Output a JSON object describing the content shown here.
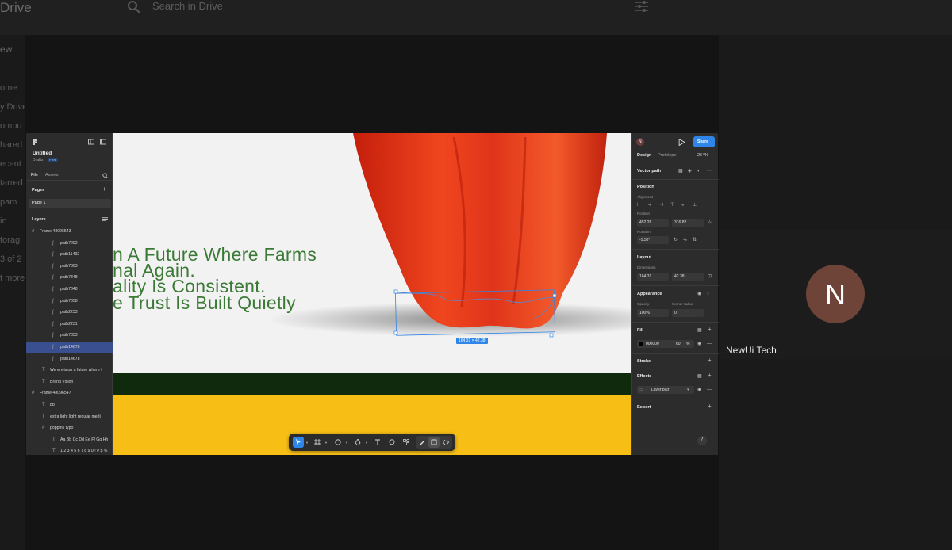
{
  "drive": {
    "title": "Drive",
    "search_placeholder": "Search in Drive",
    "new_label": "ew",
    "sidebar": [
      "ome",
      "y Drive",
      "ompu",
      "hared",
      "ecent",
      "tarred",
      "pam",
      "in",
      "torag",
      "3 of 2",
      "t more"
    ]
  },
  "figma": {
    "file": {
      "title": "Untitled",
      "subtitle": "Drafts",
      "badge": "Free"
    },
    "left_tabs": {
      "file": "File",
      "assets": "Assets"
    },
    "pages_header": "Pages",
    "page_item": "Page 1",
    "layers_header": "Layers",
    "layers": [
      {
        "icon": "#",
        "label": "Frame 48096543",
        "indent": 0
      },
      {
        "icon": "∫",
        "label": "path7292",
        "indent": 2
      },
      {
        "icon": "∫",
        "label": "path11432",
        "indent": 2
      },
      {
        "icon": "∫",
        "label": "path7363",
        "indent": 2
      },
      {
        "icon": "∫",
        "label": "path7348",
        "indent": 2
      },
      {
        "icon": "∫",
        "label": "path7348",
        "indent": 2
      },
      {
        "icon": "∫",
        "label": "path7358",
        "indent": 2
      },
      {
        "icon": "∫",
        "label": "path2233",
        "indent": 2
      },
      {
        "icon": "∫",
        "label": "path2231",
        "indent": 2
      },
      {
        "icon": "∫",
        "label": "path7353",
        "indent": 2
      },
      {
        "icon": "∫",
        "label": "path14678",
        "indent": 2,
        "selected": true
      },
      {
        "icon": "∫",
        "label": "path14678",
        "indent": 2
      },
      {
        "icon": "T",
        "label": "We envision a future where f",
        "indent": 1
      },
      {
        "icon": "T",
        "label": "Brand Vision",
        "indent": 1
      },
      {
        "icon": "#",
        "label": "Frame 48096547",
        "indent": 0
      },
      {
        "icon": "T",
        "label": "bb",
        "indent": 1
      },
      {
        "icon": "T",
        "label": "extra light light regular medi",
        "indent": 1
      },
      {
        "icon": "#",
        "label": "poppins typo",
        "indent": 1
      },
      {
        "icon": "T",
        "label": "Aa Bb Cc Dd Ee Ff Gg Hh",
        "indent": 2
      },
      {
        "icon": "T",
        "label": "1 2 3 4 5 6 7 8 9 0 ! # $ %",
        "indent": 2
      }
    ],
    "canvas": {
      "headline": [
        "n A Future Where Farms",
        "nal Again.",
        "ality Is Consistent.",
        "e Trust Is Built Quietly"
      ],
      "selection_size": "164.31 × 42.38",
      "colors": {
        "background": "#f2f2f2",
        "headline": "#3b7a36",
        "dark_band": "#0f2a0c",
        "yellow_band": "#f7be16",
        "pepper": "#d62a10"
      }
    },
    "right": {
      "avatar_initial": "N",
      "share": "Share",
      "tabs": {
        "design": "Design",
        "prototype": "Prototype",
        "zoom": "264%"
      },
      "node_title": "Vector path",
      "position": {
        "header": "Position",
        "alignment": "Alignment",
        "position_label": "Position",
        "x": "452.28",
        "y": "316.82",
        "rotation_label": "Rotation",
        "rotation": "-1.36°"
      },
      "layout": {
        "header": "Layout",
        "dimensions_label": "Dimensions",
        "w": "164.31",
        "h": "42.38"
      },
      "appearance": {
        "header": "Appearance",
        "opacity_label": "Opacity",
        "opacity": "100%",
        "radius_label": "Corner radius",
        "radius": "0"
      },
      "fill": {
        "header": "Fill",
        "hex": "000000",
        "opacity": "60",
        "unit": "%"
      },
      "stroke": {
        "header": "Stroke"
      },
      "effects": {
        "header": "Effects",
        "value": "Layer blur"
      },
      "export": {
        "header": "Export"
      },
      "help": "?"
    }
  },
  "meeting": {
    "participant_initial": "N",
    "participant_name": "NewUi Tech",
    "avatar_color": "#6d4437"
  }
}
